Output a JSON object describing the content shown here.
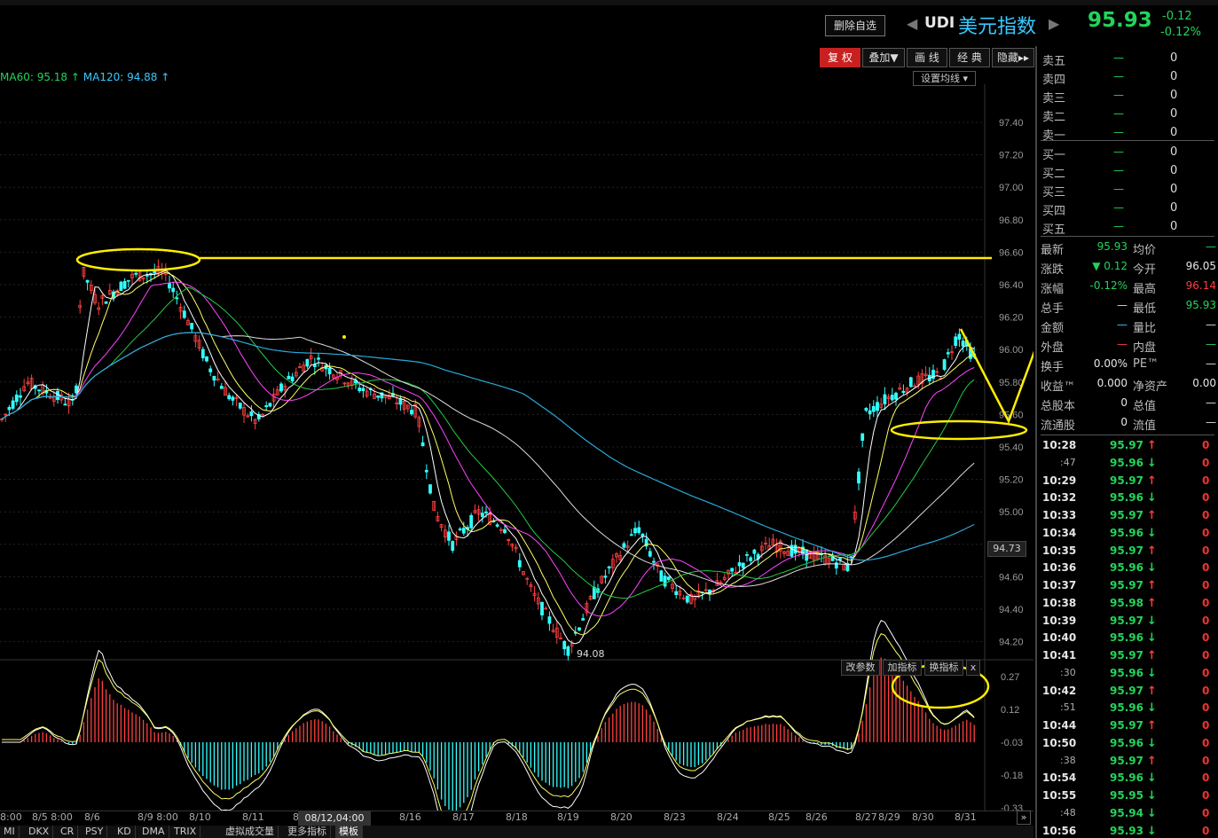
{
  "header": {
    "delete_button": "删除自选",
    "prev_arrow": "◀",
    "next_arrow": "▶",
    "symbol": "UDI",
    "name": "美元指数",
    "price": "95.93",
    "change": "-0.12",
    "change_pct": "-0.12%"
  },
  "toolbar": {
    "buttons": [
      "复 权",
      "叠加▼",
      "画 线",
      "经 典",
      "隐藏▸▸"
    ]
  },
  "ma_legend": {
    "ma60": "MA60: 95.18",
    "ma120": "MA120: 94.88"
  },
  "ma_settings_button": "设置均线 ▾",
  "y_axis_ticks": [
    "97.40",
    "97.20",
    "97.00",
    "96.80",
    "96.60",
    "96.40",
    "96.20",
    "96.00",
    "95.80",
    "95.60",
    "95.40",
    "95.20",
    "95.00",
    "94.80",
    "94.60",
    "94.40",
    "94.20"
  ],
  "current_price_label": "94.73",
  "low_label": "94.08",
  "sub_panel": {
    "buttons": [
      "改参数",
      "加指标",
      "换指标"
    ],
    "close": "x",
    "ticks": [
      "0.27",
      "0.12",
      "-0.03",
      "-0.18",
      "-0.33"
    ]
  },
  "x_axis": {
    "labels": [
      "8:00",
      "8/5 8:00",
      "8/6",
      "8/9 8:00",
      "8/10",
      "8/11",
      "8/12",
      "8/16",
      "8/17",
      "8/18",
      "8/19",
      "8/20",
      "8/23",
      "8/24",
      "8/25",
      "8/26",
      "8/27",
      "8/29",
      "8/30",
      "8/31"
    ],
    "cursor_date": "08/12,04:00",
    "scroll_right": "»"
  },
  "bottom_tabs": [
    "MI",
    "DKX",
    "CR",
    "PSY",
    "KD",
    "DMA",
    "TRIX",
    "虚拟成交量",
    "更多指标",
    "模板"
  ],
  "order_book": {
    "asks": [
      {
        "label": "卖五",
        "price": "—",
        "vol": "0"
      },
      {
        "label": "卖四",
        "price": "—",
        "vol": "0"
      },
      {
        "label": "卖三",
        "price": "—",
        "vol": "0"
      },
      {
        "label": "卖二",
        "price": "—",
        "vol": "0"
      },
      {
        "label": "卖一",
        "price": "—",
        "vol": "0"
      }
    ],
    "bids": [
      {
        "label": "买一",
        "price": "—",
        "vol": "0"
      },
      {
        "label": "买二",
        "price": "—",
        "vol": "0"
      },
      {
        "label": "买三",
        "price": "—",
        "vol": "0"
      },
      {
        "label": "买四",
        "price": "—",
        "vol": "0"
      },
      {
        "label": "买五",
        "price": "—",
        "vol": "0"
      }
    ]
  },
  "quote": [
    {
      "l1": "最新",
      "v1": "95.93",
      "c1": "#22d45a",
      "l2": "均价",
      "v2": "—",
      "c2": "#22d45a"
    },
    {
      "l1": "涨跌",
      "v1": "▼ 0.12",
      "c1": "#22d45a",
      "l2": "今开",
      "v2": "96.05",
      "c2": "#e6e6e6"
    },
    {
      "l1": "涨幅",
      "v1": "-0.12%",
      "c1": "#22d45a",
      "l2": "最高",
      "v2": "96.14",
      "c2": "#ff3b3b"
    },
    {
      "l1": "总手",
      "v1": "—",
      "c1": "#ddd",
      "l2": "最低",
      "v2": "95.93",
      "c2": "#22d45a"
    },
    {
      "l1": "金额",
      "v1": "—",
      "c1": "#39c9ff",
      "l2": "量比",
      "v2": "—",
      "c2": "#ddd"
    },
    {
      "l1": "外盘",
      "v1": "—",
      "c1": "#ff3b3b",
      "l2": "内盘",
      "v2": "—",
      "c2": "#22d45a"
    },
    {
      "l1": "换手",
      "v1": "0.00%",
      "c1": "#e6e6e6",
      "l2": "PE™",
      "v2": "—",
      "c2": "#ddd"
    },
    {
      "l1": "收益™",
      "v1": "0.000",
      "c1": "#e6e6e6",
      "l2": "净资产",
      "v2": "0.00",
      "c2": "#e6e6e6"
    },
    {
      "l1": "总股本",
      "v1": "0",
      "c1": "#e6e6e6",
      "l2": "总值",
      "v2": "—",
      "c2": "#ddd"
    },
    {
      "l1": "流通股",
      "v1": "0",
      "c1": "#e6e6e6",
      "l2": "流值",
      "v2": "—",
      "c2": "#ddd"
    }
  ],
  "ticks": [
    {
      "time": "10:28",
      "sub": false,
      "price": "95.97",
      "dir": "up",
      "vol": "0"
    },
    {
      "time": ":47",
      "sub": true,
      "price": "95.96",
      "dir": "down",
      "vol": "0"
    },
    {
      "time": "10:29",
      "sub": false,
      "price": "95.97",
      "dir": "up",
      "vol": "0"
    },
    {
      "time": "10:32",
      "sub": false,
      "price": "95.96",
      "dir": "down",
      "vol": "0"
    },
    {
      "time": "10:33",
      "sub": false,
      "price": "95.97",
      "dir": "up",
      "vol": "0"
    },
    {
      "time": "10:34",
      "sub": false,
      "price": "95.96",
      "dir": "down",
      "vol": "0"
    },
    {
      "time": "10:35",
      "sub": false,
      "price": "95.97",
      "dir": "up",
      "vol": "0"
    },
    {
      "time": "10:36",
      "sub": false,
      "price": "95.96",
      "dir": "down",
      "vol": "0"
    },
    {
      "time": "10:37",
      "sub": false,
      "price": "95.97",
      "dir": "up",
      "vol": "0"
    },
    {
      "time": "10:38",
      "sub": false,
      "price": "95.98",
      "dir": "up",
      "vol": "0"
    },
    {
      "time": "10:39",
      "sub": false,
      "price": "95.97",
      "dir": "down",
      "vol": "0"
    },
    {
      "time": "10:40",
      "sub": false,
      "price": "95.96",
      "dir": "down",
      "vol": "0"
    },
    {
      "time": "10:41",
      "sub": false,
      "price": "95.97",
      "dir": "up",
      "vol": "0"
    },
    {
      "time": ":30",
      "sub": true,
      "price": "95.96",
      "dir": "down",
      "vol": "0"
    },
    {
      "time": "10:42",
      "sub": false,
      "price": "95.97",
      "dir": "up",
      "vol": "0"
    },
    {
      "time": ":51",
      "sub": true,
      "price": "95.96",
      "dir": "down",
      "vol": "0"
    },
    {
      "time": "10:44",
      "sub": false,
      "price": "95.97",
      "dir": "up",
      "vol": "0"
    },
    {
      "time": "10:50",
      "sub": false,
      "price": "95.96",
      "dir": "down",
      "vol": "0"
    },
    {
      "time": ":38",
      "sub": true,
      "price": "95.97",
      "dir": "up",
      "vol": "0"
    },
    {
      "time": "10:54",
      "sub": false,
      "price": "95.96",
      "dir": "down",
      "vol": "0"
    },
    {
      "time": "10:55",
      "sub": false,
      "price": "95.95",
      "dir": "down",
      "vol": "0"
    },
    {
      "time": ":48",
      "sub": true,
      "price": "95.94",
      "dir": "down",
      "vol": "0"
    },
    {
      "time": "10:56",
      "sub": false,
      "price": "95.93",
      "dir": "down",
      "vol": "0"
    }
  ],
  "colors": {
    "up": "#ff3b3b",
    "down": "#22d45a",
    "accent": "#39c9ff",
    "annotation": "#ffee00"
  }
}
